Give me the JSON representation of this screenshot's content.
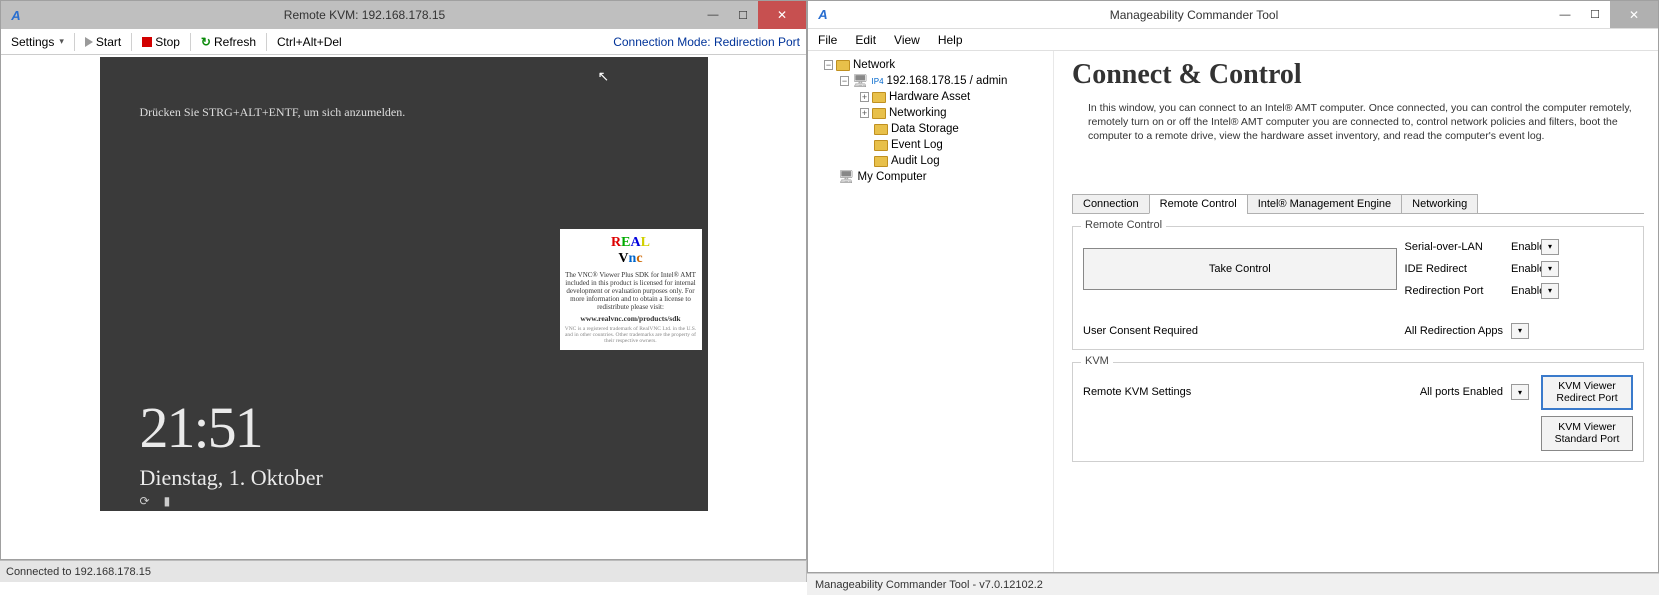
{
  "left": {
    "title": "Remote KVM: 192.168.178.15",
    "toolbar": {
      "settings": "Settings",
      "start": "Start",
      "stop": "Stop",
      "refresh": "Refresh",
      "ctrlaltdel": "Ctrl+Alt+Del",
      "conn_mode": "Connection Mode: Redirection Port"
    },
    "screen": {
      "prompt": "Drücken Sie STRG+ALT+ENTF, um sich anzumelden.",
      "time": "21:51",
      "date": "Dienstag, 1. Oktober",
      "vnc_text": "The VNC® Viewer Plus SDK for Intel® AMT included in this product is licensed for internal development or evaluation purposes only. For more information and to obtain a license to redistribute please visit:",
      "vnc_link": "www.realvnc.com/products/sdk",
      "vnc_foot": "VNC is a registered trademark of RealVNC Ltd. in the U.S. and in other countries. Other trademarks are the property of their respective owners."
    },
    "status": "Connected to 192.168.178.15"
  },
  "right": {
    "title": "Manageability Commander Tool",
    "menu": {
      "file": "File",
      "edit": "Edit",
      "view": "View",
      "help": "Help"
    },
    "tree": {
      "network": "Network",
      "host": "192.168.178.15 / admin",
      "hardware": "Hardware Asset",
      "networking": "Networking",
      "datastorage": "Data Storage",
      "eventlog": "Event Log",
      "auditlog": "Audit Log",
      "mycomputer": "My Computer"
    },
    "content": {
      "heading": "Connect & Control",
      "desc": "In this window, you can connect to an Intel® AMT computer. Once connected, you can control the computer remotely, remotely turn on or off the Intel® AMT computer you are connected to, control network policies and filters, boot the computer to a remote drive, view the hardware asset inventory, and read the computer's event log.",
      "tabs": {
        "t1": "Connection",
        "t2": "Remote Control",
        "t3": "Intel® Management Engine",
        "t4": "Networking"
      },
      "rc": {
        "group": "Remote Control",
        "sol": "Serial-over-LAN",
        "sol_v": "Enabled",
        "ide": "IDE Redirect",
        "ide_v": "Enabled",
        "redir": "Redirection Port",
        "redir_v": "Enabled",
        "consent": "User Consent Required",
        "consent_v": "All Redirection Apps",
        "take": "Take Control"
      },
      "kvm": {
        "group": "KVM",
        "settings": "Remote KVM Settings",
        "settings_v": "All ports Enabled",
        "btn1a": "KVM Viewer",
        "btn1b": "Redirect Port",
        "btn2a": "KVM Viewer",
        "btn2b": "Standard Port"
      }
    },
    "status": "Manageability Commander Tool - v7.0.12102.2"
  }
}
